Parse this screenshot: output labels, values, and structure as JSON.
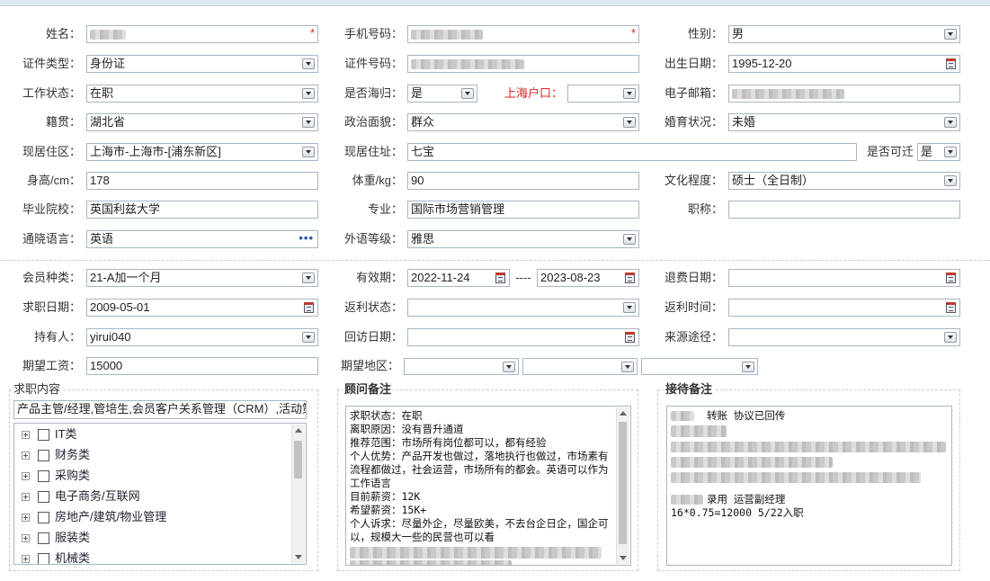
{
  "form": {
    "name": {
      "label": "姓名：",
      "required": "*"
    },
    "phone": {
      "label": "手机号码：",
      "required": "*"
    },
    "gender": {
      "label": "性别：",
      "value": "男"
    },
    "id_type": {
      "label": "证件类型：",
      "value": "身份证"
    },
    "id_number": {
      "label": "证件号码："
    },
    "birth_date": {
      "label": "出生日期：",
      "value": "1995-12-20"
    },
    "work_status": {
      "label": "工作状态：",
      "value": "在职"
    },
    "returnee": {
      "label": "是否海归：",
      "value": "是"
    },
    "shanghai_hukou": {
      "label": "上海户口："
    },
    "email": {
      "label": "电子邮箱："
    },
    "native_place": {
      "label": "籍贯：",
      "value": "湖北省"
    },
    "political": {
      "label": "政治面貌：",
      "value": "群众"
    },
    "marital": {
      "label": "婚育状况：",
      "value": "未婚"
    },
    "residence_area": {
      "label": "现居住区：",
      "value": "上海市-上海市-[浦东新区]"
    },
    "residence_addr": {
      "label": "现居住址：",
      "value": "七宝"
    },
    "relocate": {
      "label": "是否可迁",
      "value": "是"
    },
    "height": {
      "label": "身高/cm：",
      "value": "178"
    },
    "weight": {
      "label": "体重/kg：",
      "value": "90"
    },
    "education": {
      "label": "文化程度：",
      "value": "硕士（全日制）"
    },
    "school": {
      "label": "毕业院校：",
      "value": "英国利兹大学"
    },
    "major": {
      "label": "专业：",
      "value": "国际市场营销管理"
    },
    "title": {
      "label": "职称："
    },
    "language": {
      "label": "通晓语言：",
      "value": "英语",
      "more": "•••"
    },
    "lang_level": {
      "label": "外语等级：",
      "value": "雅思"
    }
  },
  "membership": {
    "member_type": {
      "label": "会员种类：",
      "value": "21-A加一个月"
    },
    "validity": {
      "label": "有效期：",
      "start": "2022-11-24",
      "sep": "----",
      "end": "2023-08-23"
    },
    "refund_date": {
      "label": "退费日期："
    },
    "job_seek_date": {
      "label": "求职日期：",
      "value": "2009-05-01"
    },
    "rebate_status": {
      "label": "返利状态："
    },
    "rebate_time": {
      "label": "返利时间："
    },
    "holder": {
      "label": "持有人：",
      "value": "yirui040"
    },
    "visit_date": {
      "label": "回访日期："
    },
    "source": {
      "label": "来源途径："
    },
    "expected_salary": {
      "label": "期望工资：",
      "value": "15000"
    },
    "expected_area": {
      "label": "期望地区："
    }
  },
  "job_content": {
    "legend": "求职内容",
    "value": "产品主管/经理,管培生,会员客户关系管理（CRM）,活动策",
    "categories": [
      "IT类",
      "财务类",
      "采购类",
      "电子商务/互联网",
      "房地产/建筑/物业管理",
      "服装类",
      "机械类"
    ]
  },
  "consultant_notes": {
    "legend": "顾问备注",
    "lines": [
      "求职状态：在职",
      "离职原因：没有晋升通道",
      "推荐范围：市场所有岗位都可以，都有经验",
      "个人优势：产品开发也做过，落地执行也做过，市场素有流程都做过，社会运营，市场所有的都会。英语可以作为工作语言",
      "目前薪资：12K",
      "希望薪资：15K+",
      "个人诉求：尽量外企，尽量欧美，不去台企日企，国企可以，规模大一些的民营也可以看"
    ]
  },
  "reception_notes": {
    "legend": "接待备注",
    "line1": "转账 协议已回传",
    "line2": "录用  运营副经理",
    "line3": "16*0.75=12000  5/22入职"
  }
}
